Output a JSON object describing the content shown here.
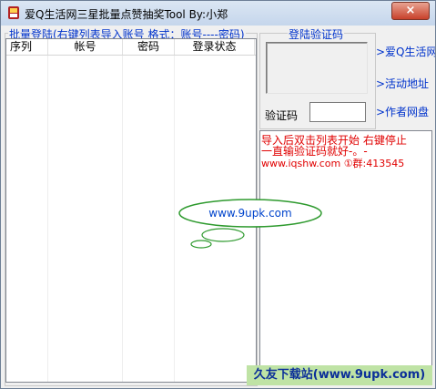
{
  "window": {
    "title": "爱Q生活网三星批量点赞抽奖Tool   By:小郑",
    "close_glyph": "×"
  },
  "batch_group": {
    "title": "批量登陆(右键列表导入账号 格式：账号----密码)",
    "columns": [
      "序列",
      "帐号",
      "密码",
      "登录状态"
    ],
    "rows": []
  },
  "captcha_group": {
    "title": "登陆验证码",
    "input_label": "验证码",
    "input_value": ""
  },
  "side_links": [
    ">爱Q生活网",
    ">活动地址",
    ">作者网盘"
  ],
  "log": {
    "lines": [
      "导入后双击列表开始 右键停止",
      "一直输验证码就好-。-",
      "www.iqshw.com ①群:413545"
    ]
  },
  "watermark": {
    "bubble_text": "www.9upk.com",
    "banner_text": "久友下载站(www.9upk.com)"
  }
}
